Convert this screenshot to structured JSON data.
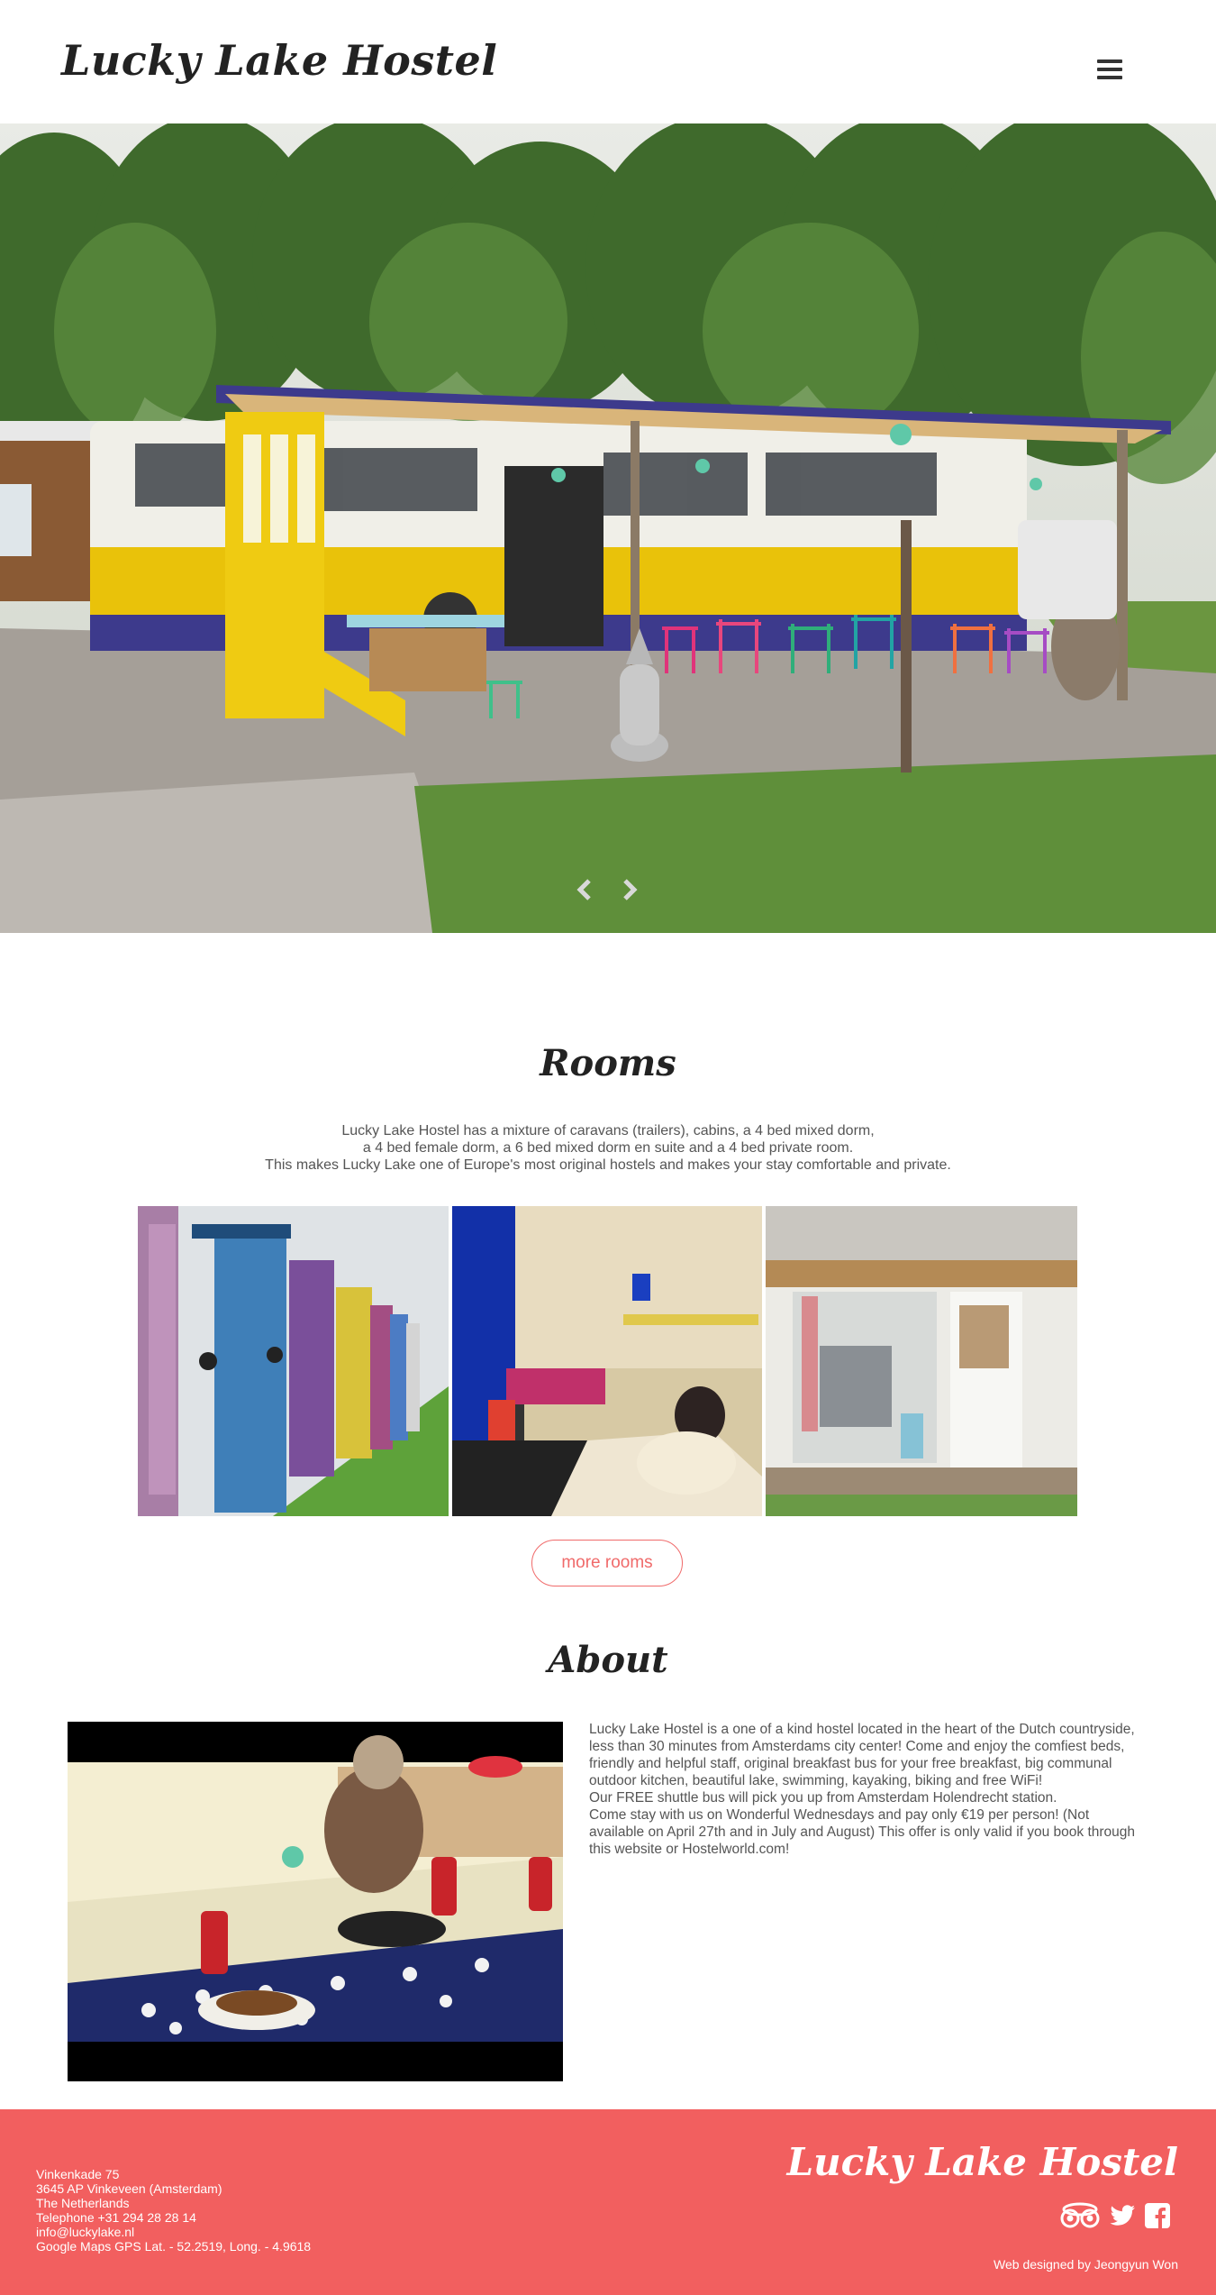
{
  "header": {
    "logo": "Lucky Lake Hostel",
    "menu_icon": "hamburger-icon"
  },
  "hero": {
    "prev_icon": "chevron-left-icon",
    "next_icon": "chevron-right-icon"
  },
  "rooms": {
    "title": "Rooms",
    "description": [
      "Lucky Lake Hostel has a mixture of caravans (trailers), cabins, a 4 bed mixed dorm,",
      "a 4 bed female dorm, a 6 bed mixed dorm en suite and a 4 bed private room.",
      "This makes Lucky Lake one of Europe's most original hostels and makes your stay comfortable and private."
    ],
    "more_button": "more rooms"
  },
  "about": {
    "title": "About",
    "paragraphs": [
      "Lucky Lake Hostel is a one of a kind hostel located in the heart of the Dutch countryside, less than 30 minutes from Amsterdams city center! Come and enjoy the comfiest beds, friendly and helpful staff, original breakfast bus for your free breakfast, big communal outdoor kitchen, beautiful lake, swimming, kayaking, biking and free WiFi!",
      "Our FREE shuttle bus will pick you up from Amsterdam Holendrecht station.",
      "Come stay with us on Wonderful Wednesdays and pay only €19 per person! (Not available on April 27th and in July and August) This offer is only valid if you book through this website or Hostelworld.com!"
    ]
  },
  "footer": {
    "address": [
      "Vinkenkade 75",
      "3645 AP Vinkeveen (Amsterdam)",
      "The Netherlands",
      "Telephone +31 294 28 28 14",
      "info@luckylake.nl",
      "Google Maps GPS Lat. - 52.2519, Long. - 4.9618"
    ],
    "logo": "Lucky Lake Hostel",
    "social_icons": [
      "tripadvisor-icon",
      "twitter-icon",
      "facebook-icon"
    ],
    "credit": "Web designed by Jeongyun Won"
  },
  "colors": {
    "accent": "#f25f5f",
    "text": "#555555",
    "heading": "#222222"
  }
}
